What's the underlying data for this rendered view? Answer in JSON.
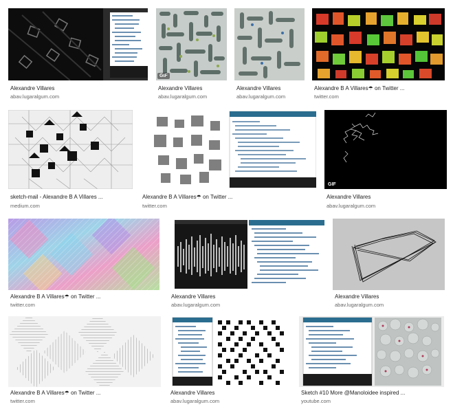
{
  "results": [
    {
      "title": "Alexandre Villares",
      "source": "abav.lugaralgum.com"
    },
    {
      "title": "Alexandre Villares",
      "source": "abav.lugaralgum.com",
      "badge": "GIF"
    },
    {
      "title": "Alexandre Villares",
      "source": "abav.lugaralgum.com"
    },
    {
      "title": "Alexandre B A Villares☂ on Twitter ...",
      "source": "twitter.com"
    },
    {
      "title": "sketch-mail - Alexandre B A Villares ...",
      "source": "medium.com"
    },
    {
      "title": "Alexandre B A Villares☂ on Twitter ...",
      "source": "twitter.com"
    },
    {
      "title": "Alexandre Villares",
      "source": "abav.lugaralgum.com",
      "badge": "GIF"
    },
    {
      "title": "Alexandre B A Villares☂ on Twitter ...",
      "source": "twitter.com"
    },
    {
      "title": "Alexandre Villares",
      "source": "abav.lugaralgum.com"
    },
    {
      "title": "Alexandre Villares",
      "source": "abav.lugaralgum.com"
    },
    {
      "title": "Alexandre B A Villares☂ on Twitter ...",
      "source": "twitter.com"
    },
    {
      "title": "Alexandre Villares",
      "source": "abav.lugaralgum.com"
    },
    {
      "title": "Sketch #10 More @Manoloidee inspired ...",
      "source": "youtube.com"
    }
  ]
}
